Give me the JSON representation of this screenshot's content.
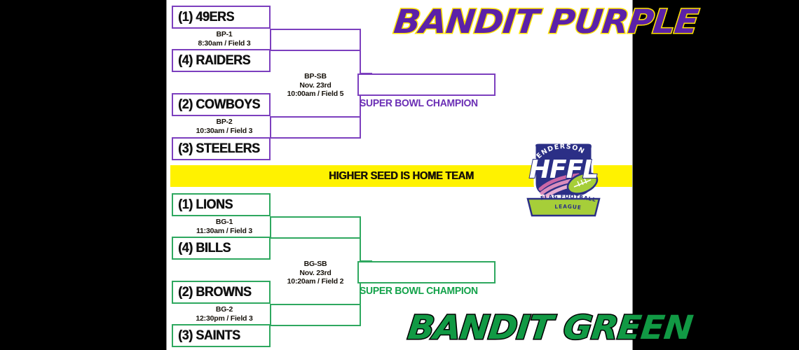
{
  "page": {
    "background_color": "#000000",
    "canvas_color": "#ffffff"
  },
  "brackets": [
    {
      "id": "bandit-purple",
      "wordmark": "BANDIT PURPLE",
      "color": "#7C3FBE",
      "wordmark_color": "#5B21A8",
      "wordmark_outline": "#FFE400",
      "champion_label": "SUPER BOWL CHAMPION",
      "teams": [
        {
          "seed": "(1)",
          "name": "49ERS",
          "label": "(1) 49ERS"
        },
        {
          "seed": "(4)",
          "name": "RAIDERS",
          "label": "(4) RAIDERS"
        },
        {
          "seed": "(2)",
          "name": "COWBOYS",
          "label": "(2) COWBOYS"
        },
        {
          "seed": "(3)",
          "name": "STEELERS",
          "label": "(3) STEELERS"
        }
      ],
      "games": [
        {
          "code": "BP-1",
          "date": "",
          "time_field": "8:30am / Field 3"
        },
        {
          "code": "BP-2",
          "date": "",
          "time_field": "10:30am / Field 3"
        },
        {
          "code": "BP-SB",
          "date": "Nov. 23rd",
          "time_field": "10:00am / Field 5"
        }
      ]
    },
    {
      "id": "bandit-green",
      "wordmark": "BANDIT GREEN",
      "color": "#2EA85F",
      "wordmark_color": "#119944",
      "wordmark_outline": "#000000",
      "champion_label": "SUPER BOWL CHAMPION",
      "teams": [
        {
          "seed": "(1)",
          "name": "LIONS",
          "label": "(1) LIONS"
        },
        {
          "seed": "(4)",
          "name": "BILLS",
          "label": "(4) BILLS"
        },
        {
          "seed": "(2)",
          "name": "BROWNS",
          "label": "(2) BROWNS"
        },
        {
          "seed": "(3)",
          "name": "SAINTS",
          "label": "(3) SAINTS"
        }
      ],
      "games": [
        {
          "code": "BG-1",
          "date": "",
          "time_field": "11:30am / Field 3"
        },
        {
          "code": "BG-2",
          "date": "",
          "time_field": "12:30pm / Field 3"
        },
        {
          "code": "BG-SB",
          "date": "Nov. 23rd",
          "time_field": "10:20am / Field 2"
        }
      ]
    }
  ],
  "home_banner": {
    "text": "HIGHER SEED IS HOME TEAM",
    "background": "#FFF200",
    "text_color": "#1a1408"
  },
  "logo": {
    "arc_text": "HENDERSON",
    "monogram": "HFFL",
    "banner_line1": "FLAG FOOTBALL",
    "banner_line2": "LEAGUE",
    "shield_color": "#2B2F86",
    "accent_color": "#A6CE39",
    "trail_color": "#D46BA8"
  }
}
